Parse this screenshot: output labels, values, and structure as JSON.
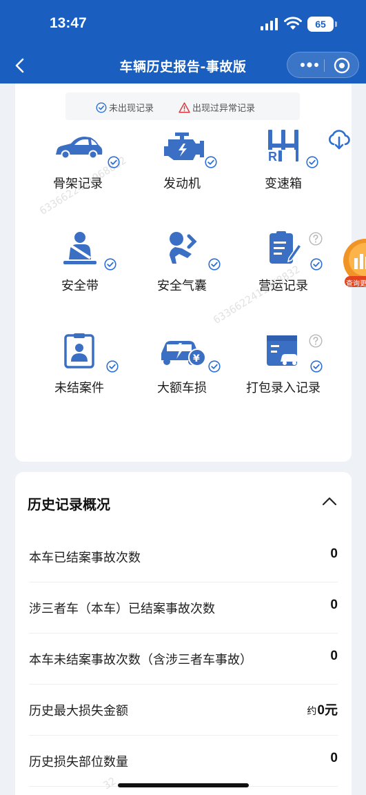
{
  "status_bar": {
    "time": "13:47",
    "battery": "65"
  },
  "nav": {
    "title": "车辆历史报告-事故版"
  },
  "legend": {
    "no_record": "未出现记录",
    "abnormal": "出现过异常记录"
  },
  "categories": [
    {
      "label": "骨架记录",
      "icon": "car-body-icon",
      "status": "checked"
    },
    {
      "label": "发动机",
      "icon": "engine-icon",
      "status": "checked"
    },
    {
      "label": "变速箱",
      "icon": "gearbox-icon",
      "status": "checked"
    },
    {
      "label": "安全带",
      "icon": "seatbelt-icon",
      "status": "checked"
    },
    {
      "label": "安全气囊",
      "icon": "airbag-icon",
      "status": "checked"
    },
    {
      "label": "营运记录",
      "icon": "operation-record-icon",
      "status": "checked",
      "help": true
    },
    {
      "label": "未结案件",
      "icon": "pending-case-icon",
      "status": "checked"
    },
    {
      "label": "大额车损",
      "icon": "major-damage-icon",
      "status": "checked"
    },
    {
      "label": "打包录入记录",
      "icon": "bundle-entry-icon",
      "status": "checked",
      "help": true
    }
  ],
  "history": {
    "title": "历史记录概况",
    "rows": [
      {
        "label": "本车已结案事故次数",
        "value": "0"
      },
      {
        "label": "涉三者车（本车）已结案事故次数",
        "value": "0"
      },
      {
        "label": "本车未结案事故次数（含涉三者车事故）",
        "value": "0"
      },
      {
        "label": "历史最大损失金额",
        "prefix": "约",
        "value": "0元"
      },
      {
        "label": "历史损失部位数量",
        "value": "0"
      }
    ]
  },
  "float_badge": {
    "label": "查询更"
  },
  "watermark": "6336622411968832",
  "colors": {
    "brand_blue": "#1a5fbf",
    "icon_blue": "#3a6fc4",
    "check_blue": "#2b6fd6",
    "warn_red": "#d9363e"
  }
}
